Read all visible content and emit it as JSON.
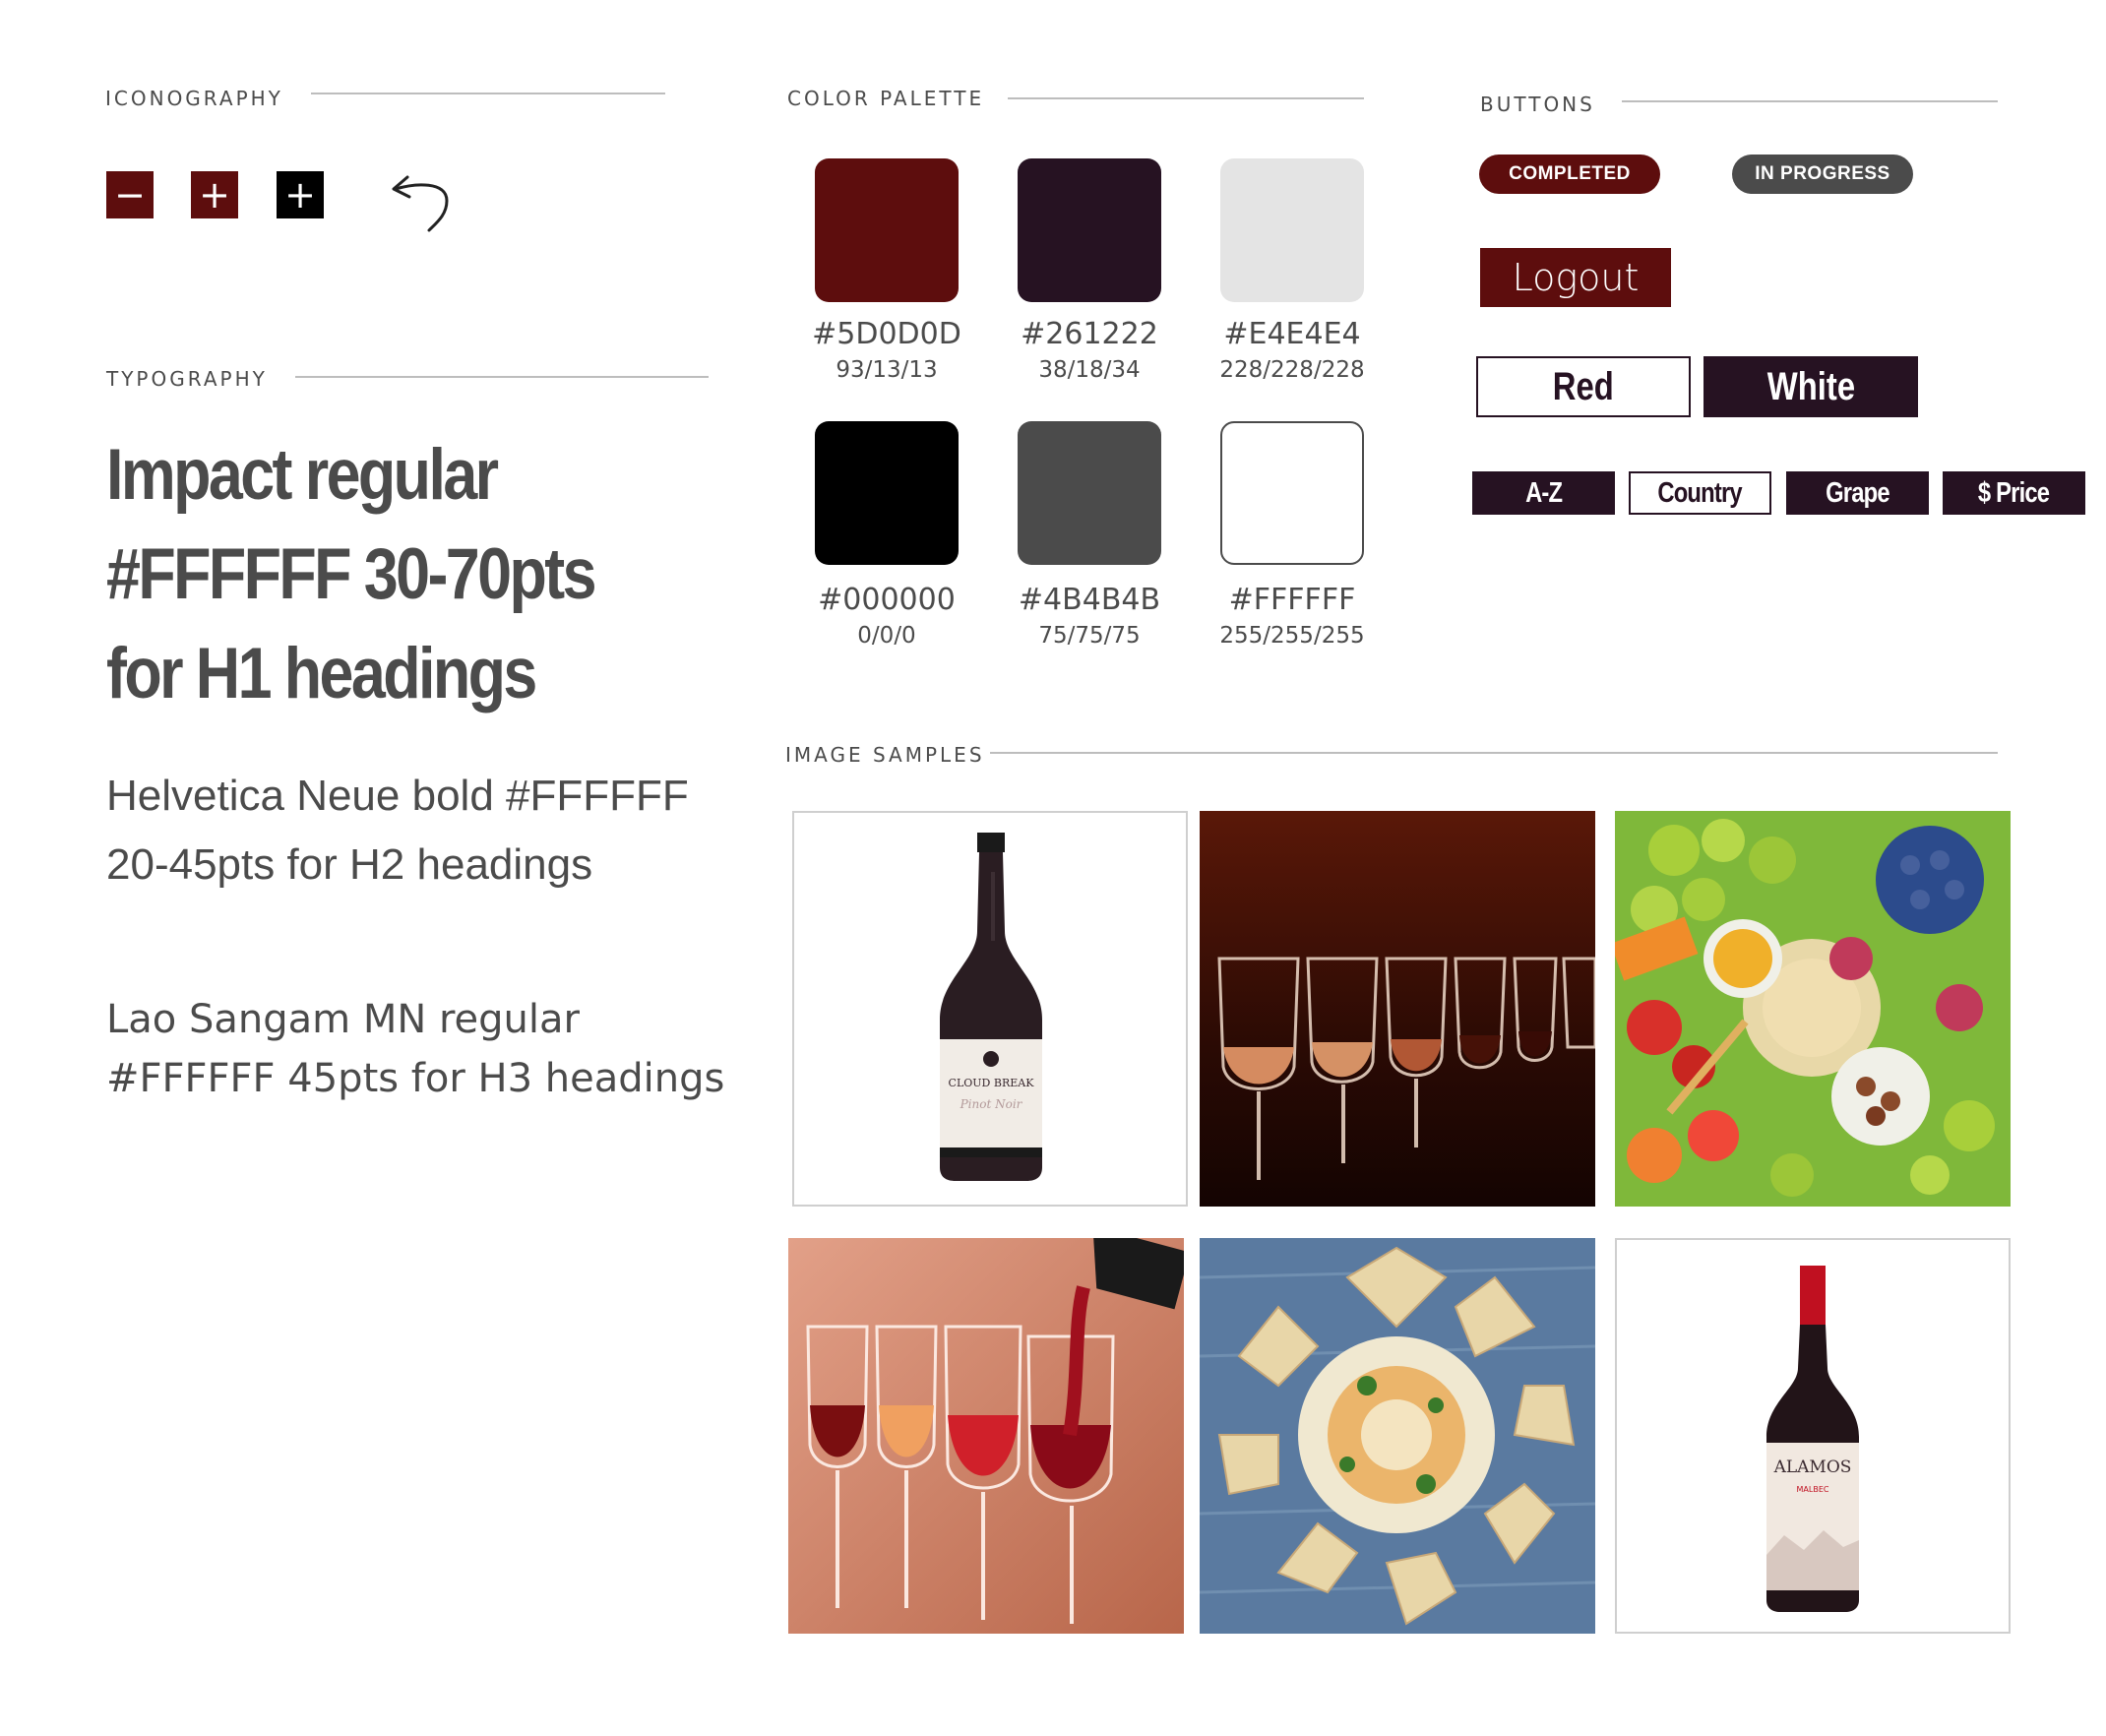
{
  "sections": {
    "iconography": "ICONOGRAPHY",
    "typography": "TYPOGRAPHY",
    "color_palette": "COLOR PALETTE",
    "buttons": "BUTTONS",
    "image_samples": "IMAGE SAMPLES"
  },
  "icons": {
    "minus": "−",
    "plus": "+",
    "plus_black": "+",
    "back": "↩"
  },
  "typography": {
    "h1_sample": "Impact regular #FFFFFF 30-70pts for H1 headings",
    "h2_sample": "Helvetica Neue bold #FFFFFF 20-45pts for H2 headings",
    "h3_sample": "Lao Sangam MN regular #FFFFFF 45pts for H3 headings"
  },
  "palette": [
    {
      "hex": "#5D0D0D",
      "rgb": "93/13/13",
      "color": "#5D0D0D"
    },
    {
      "hex": "#261222",
      "rgb": "38/18/34",
      "color": "#261222"
    },
    {
      "hex": "#E4E4E4",
      "rgb": "228/228/228",
      "color": "#E4E4E4"
    },
    {
      "hex": "#000000",
      "rgb": "0/0/0",
      "color": "#000000"
    },
    {
      "hex": "#4B4B4B",
      "rgb": "75/75/75",
      "color": "#4B4B4B"
    },
    {
      "hex": "#FFFFFF",
      "rgb": "255/255/255",
      "color": "#FFFFFF"
    }
  ],
  "buttons": {
    "completed": "COMPLETED",
    "in_progress": "IN PROGRESS",
    "logout": "Logout",
    "red": "Red",
    "white": "White",
    "sort": [
      "A-Z",
      "Country",
      "Grape",
      "$ Price"
    ]
  },
  "images": {
    "bottle1_label": "CLOUD BREAK",
    "bottle1_sub": "Pinot Noir",
    "bottle2_label": "ALAMOS",
    "bottle2_sub": "MALBEC"
  }
}
